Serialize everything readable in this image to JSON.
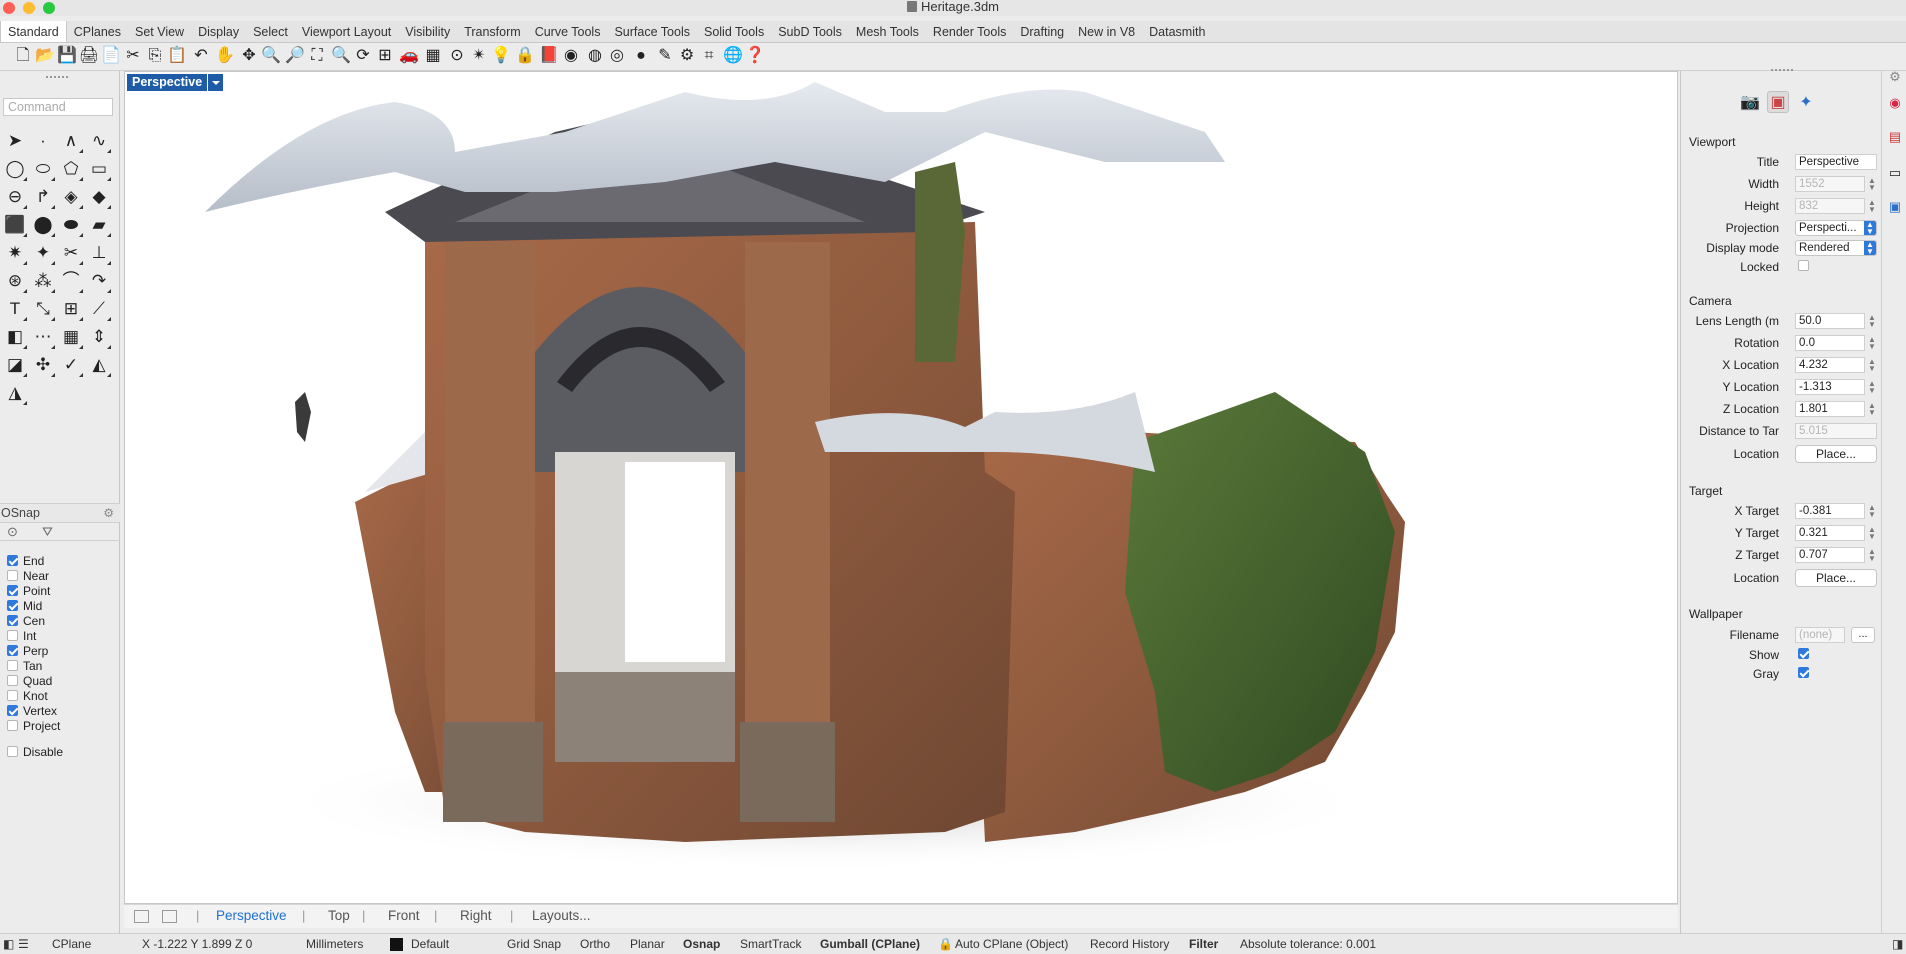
{
  "window": {
    "title": "Heritage.3dm"
  },
  "tabs": [
    "Standard",
    "CPlanes",
    "Set View",
    "Display",
    "Select",
    "Viewport Layout",
    "Visibility",
    "Transform",
    "Curve Tools",
    "Surface Tools",
    "Solid Tools",
    "SubD Tools",
    "Mesh Tools",
    "Render Tools",
    "Drafting",
    "New in V8",
    "Datasmith"
  ],
  "toolbar_icons": [
    "new-icon",
    "open-icon",
    "save-icon",
    "print-icon",
    "import-icon",
    "cut-icon",
    "copy-icon",
    "paste-icon",
    "undo-icon",
    "pan-icon",
    "rotate-view-icon",
    "zoom-icon",
    "zoom-window-icon",
    "zoom-extents-icon",
    "zoom-selected-icon",
    "rotate-icon",
    "four-views-icon",
    "car-icon",
    "cplane-icon",
    "point-icon",
    "lights-icon",
    "lightbulb-icon",
    "lock-icon",
    "material-icon",
    "color-wheel-icon",
    "wireframe-sphere-icon",
    "shaded-sphere-icon",
    "render-sphere-icon",
    "pencil-icon",
    "gear-icon",
    "grid-icon",
    "globe-icon",
    "help-icon"
  ],
  "command": {
    "placeholder": "Command"
  },
  "osnap": {
    "title": "OSnap",
    "items": [
      {
        "label": "End",
        "checked": true
      },
      {
        "label": "Near",
        "checked": false
      },
      {
        "label": "Point",
        "checked": true
      },
      {
        "label": "Mid",
        "checked": true
      },
      {
        "label": "Cen",
        "checked": true
      },
      {
        "label": "Int",
        "checked": false
      },
      {
        "label": "Perp",
        "checked": true
      },
      {
        "label": "Tan",
        "checked": false
      },
      {
        "label": "Quad",
        "checked": false
      },
      {
        "label": "Knot",
        "checked": false
      },
      {
        "label": "Vertex",
        "checked": true
      },
      {
        "label": "Project",
        "checked": false
      }
    ],
    "disable_label": "Disable"
  },
  "viewport": {
    "title": "Perspective"
  },
  "view_tabs": [
    "Perspective",
    "Top",
    "Front",
    "Right",
    "Layouts..."
  ],
  "properties": {
    "viewport_section": "Viewport",
    "title_label": "Title",
    "title_value": "Perspective",
    "width_label": "Width",
    "width_value": "1552",
    "height_label": "Height",
    "height_value": "832",
    "projection_label": "Projection",
    "projection_value": "Perspecti...",
    "display_mode_label": "Display mode",
    "display_mode_value": "Rendered",
    "locked_label": "Locked",
    "camera_section": "Camera",
    "lens_label": "Lens Length (m",
    "lens_value": "50.0",
    "rotation_label": "Rotation",
    "rotation_value": "0.0",
    "xloc_label": "X Location",
    "xloc_value": "4.232",
    "yloc_label": "Y Location",
    "yloc_value": "-1.313",
    "zloc_label": "Z Location",
    "zloc_value": "1.801",
    "dist_label": "Distance to Tar",
    "dist_value": "5.015",
    "location_label": "Location",
    "place_label": "Place...",
    "target_section": "Target",
    "xt_label": "X Target",
    "xt_value": "-0.381",
    "yt_label": "Y Target",
    "yt_value": "0.321",
    "zt_label": "Z Target",
    "zt_value": "0.707",
    "wallpaper_section": "Wallpaper",
    "filename_label": "Filename",
    "filename_value": "(none)",
    "browse_label": "...",
    "show_label": "Show",
    "gray_label": "Gray"
  },
  "status": {
    "cplane": "CPlane",
    "coords": "X -1.222 Y 1.899 Z 0",
    "units": "Millimeters",
    "layer": "Default",
    "grid_snap": "Grid Snap",
    "ortho": "Ortho",
    "planar": "Planar",
    "osnap": "Osnap",
    "smarttrack": "SmartTrack",
    "gumball": "Gumball (CPlane)",
    "auto_cplane": "Auto CPlane (Object)",
    "record_history": "Record History",
    "filter": "Filter",
    "tolerance": "Absolute tolerance: 0.001"
  }
}
